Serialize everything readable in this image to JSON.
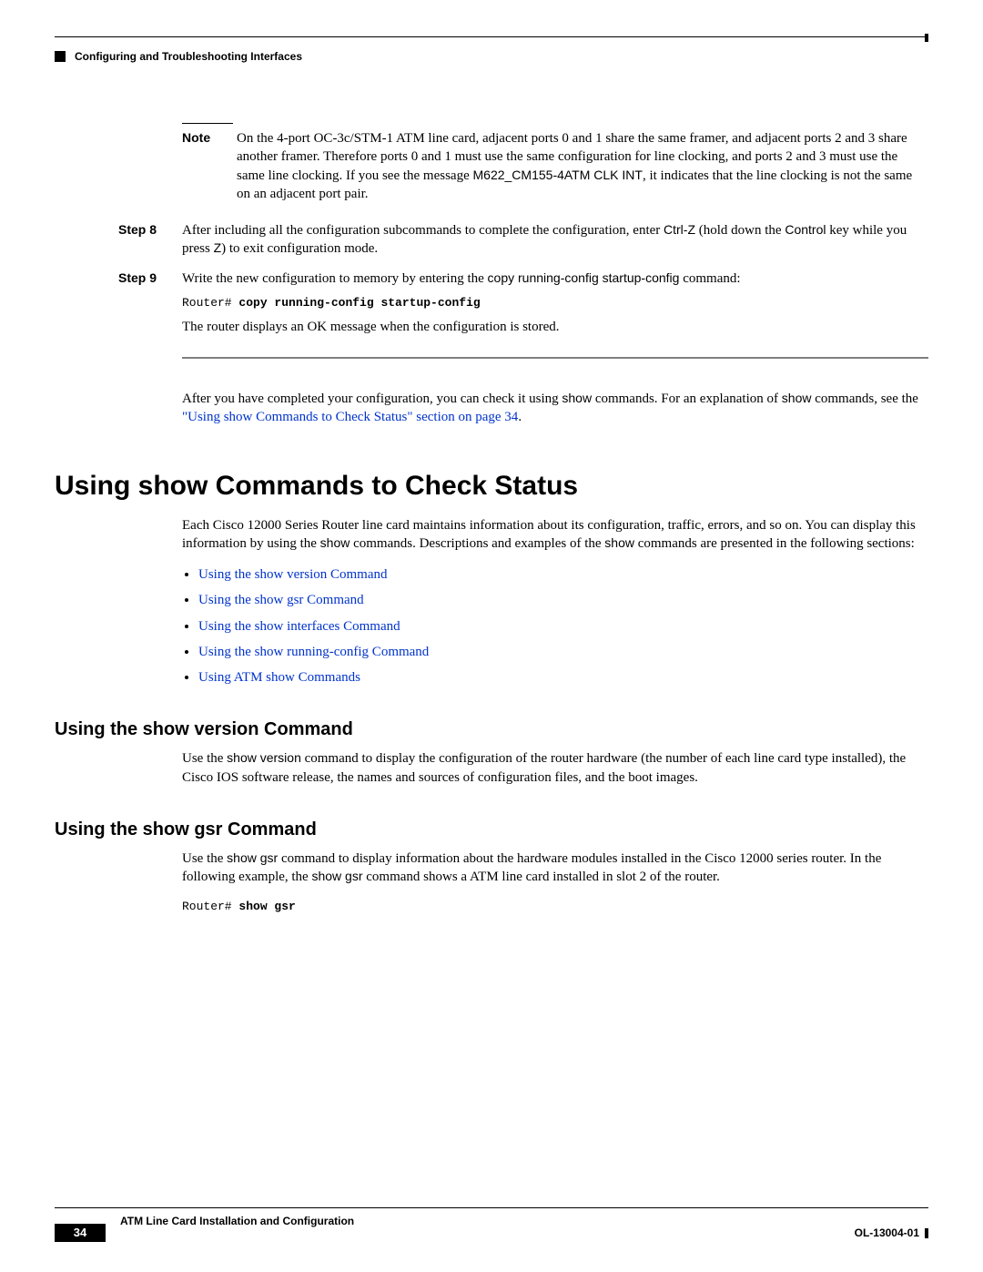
{
  "running_head": "Configuring and Troubleshooting Interfaces",
  "note": {
    "label": "Note",
    "body_pre": "On the 4-port OC-3c/STM-1 ATM line card, adjacent ports 0 and 1 share the same framer, and adjacent ports 2 and 3 share another framer. Therefore ports 0 and 1 must use the same configuration for line clocking, and ports 2 and 3 must use the same line clocking. If you see the message ",
    "msg": "M622_CM155-4ATM CLK INT",
    "body_post": ", it indicates that the line clocking is not the same on an adjacent port pair."
  },
  "step8": {
    "label": "Step 8",
    "pre": "After including all the configuration subcommands to complete the configuration, enter ",
    "ctrlz": "Ctrl-Z",
    "mid": " (hold down the ",
    "control": "Control",
    "mid2": " key while you press ",
    "z": "Z",
    "post": ") to exit configuration mode."
  },
  "step9": {
    "label": "Step 9",
    "pre": "Write the new configuration to memory by entering the ",
    "cmd": "copy running-config startup-config",
    "post": " command:",
    "code_prompt": "Router# ",
    "code_cmd": "copy running-config startup-config",
    "ok_msg": "The router displays an OK message when the configuration is stored."
  },
  "after_para": {
    "pre": "After you have completed your configuration, you can check it using ",
    "show1": "show",
    "mid": " commands. For an explanation of ",
    "show2": "show",
    "mid2": " commands, see the ",
    "xref": "\"Using show Commands to Check Status\" section on page 34",
    "end": "."
  },
  "h1": "Using show Commands to Check Status",
  "h1_body": {
    "pre": "Each Cisco 12000 Series Router line card maintains information about its configuration, traffic, errors, and so on. You can display this information by using the ",
    "show1": "show",
    "mid": " commands. Descriptions and examples of the ",
    "show2": "show",
    "post": " commands are presented in the following sections:"
  },
  "links": [
    "Using the show version Command",
    "Using the show gsr Command",
    "Using the show interfaces Command",
    "Using the show running-config Command",
    "Using ATM show Commands"
  ],
  "h2a": "Using the show version Command",
  "h2a_body": {
    "pre": "Use the ",
    "cmd": "show version",
    "post": " command to display the configuration of the router hardware (the number of each line card type installed), the Cisco IOS software release, the names and sources of configuration files, and the boot images."
  },
  "h2b": "Using the show gsr Command",
  "h2b_body": {
    "pre": "Use the ",
    "cmd1": "show gsr",
    "mid": " command to display information about the hardware modules installed in the Cisco 12000 series router. In the following example, the ",
    "cmd2": "show gsr",
    "post": " command shows a ATM line card installed in slot 2 of the router."
  },
  "code2_prompt": "Router# ",
  "code2_cmd": "show gsr",
  "footer_title": "ATM Line Card Installation and Configuration",
  "page_num": "34",
  "doc_id": "OL-13004-01"
}
